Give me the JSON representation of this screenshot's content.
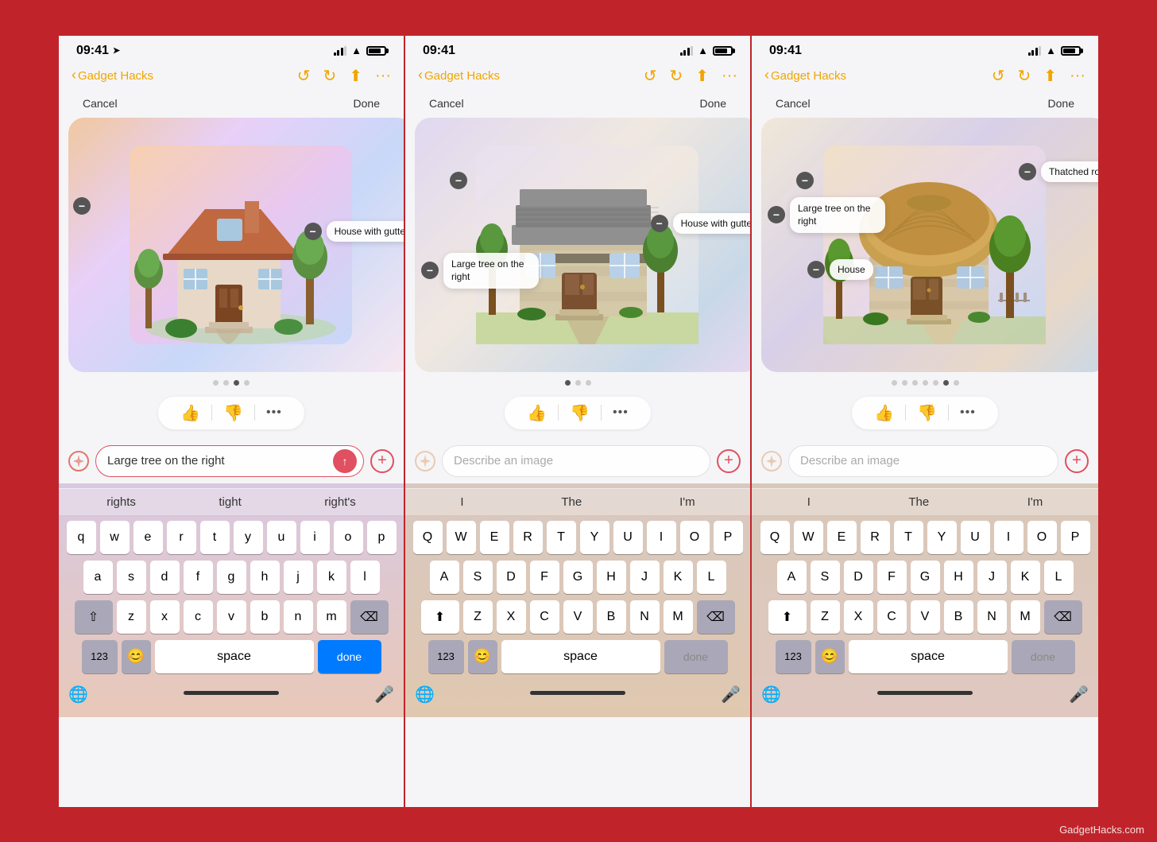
{
  "app": {
    "title": "GadgetHacks.com",
    "watermark": "GadgetHacks.com"
  },
  "phones": [
    {
      "id": "phone-1",
      "status": {
        "time": "09:41",
        "location_arrow": true
      },
      "nav": {
        "back_label": "Gadget Hacks"
      },
      "toolbar": {
        "cancel": "Cancel",
        "done": "Done"
      },
      "image": {
        "type": "house1",
        "annotations": [
          {
            "id": "a1",
            "label": "House with gutters",
            "position": "right"
          },
          {
            "id": "a2",
            "label": "",
            "position": "left"
          }
        ]
      },
      "pagination": {
        "dots": 4,
        "active": 2
      },
      "input": {
        "value": "Large tree on the right",
        "placeholder": "Describe an image",
        "has_text": true
      },
      "suggestions": [
        "rights",
        "tight",
        "right's"
      ],
      "keyboard_type": "lowercase"
    },
    {
      "id": "phone-2",
      "status": {
        "time": "09:41"
      },
      "nav": {
        "back_label": "Gadget Hacks"
      },
      "toolbar": {
        "cancel": "Cancel",
        "done": "Done"
      },
      "image": {
        "type": "house2",
        "annotations": [
          {
            "id": "b1",
            "label": "House with gutters",
            "position": "right"
          },
          {
            "id": "b2",
            "label": "Large tree on the right",
            "position": "left"
          }
        ]
      },
      "pagination": {
        "dots": 3,
        "active": 0
      },
      "input": {
        "value": "",
        "placeholder": "Describe an image",
        "has_text": false
      },
      "suggestions": [
        "I",
        "The",
        "I'm"
      ],
      "keyboard_type": "uppercase"
    },
    {
      "id": "phone-3",
      "status": {
        "time": "09:41"
      },
      "nav": {
        "back_label": "Gadget Hacks"
      },
      "toolbar": {
        "cancel": "Cancel",
        "done": "Done"
      },
      "image": {
        "type": "house3",
        "annotations": [
          {
            "id": "c1",
            "label": "Thatched roof",
            "position": "top-right"
          },
          {
            "id": "c2",
            "label": "Large tree on the right",
            "position": "left"
          },
          {
            "id": "c3",
            "label": "House",
            "position": "bottom-left"
          }
        ]
      },
      "pagination": {
        "dots": 6,
        "active": 5
      },
      "input": {
        "value": "",
        "placeholder": "Describe an image",
        "has_text": false
      },
      "suggestions": [
        "I",
        "The",
        "I'm"
      ],
      "keyboard_type": "uppercase"
    }
  ]
}
